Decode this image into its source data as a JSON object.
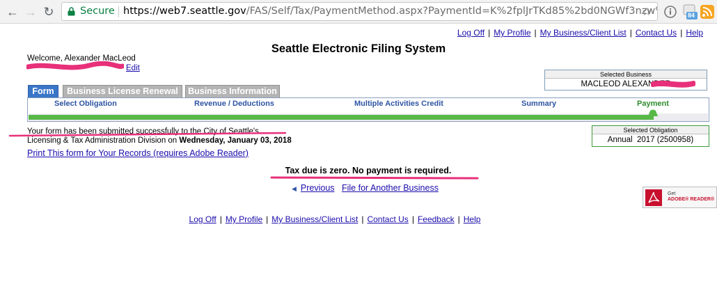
{
  "browser": {
    "secure_label": "Secure",
    "url_host": "https://web7.seattle.gov",
    "url_rest": "/FAS/Self/Tax/PaymentMethod.aspx?PaymentId=K%2fplJrTKd85%2bd0NGWf3nzw%3d%...",
    "extension_badge": "84"
  },
  "top_links": [
    "Log Off",
    "My Profile",
    "My Business/Client List",
    "Contact Us",
    "Help"
  ],
  "app_title": "Seattle Electronic Filing System",
  "welcome": "Welcome, Alexander MacLeod",
  "edit_label": "Edit",
  "selected_business": {
    "label": "Selected Business",
    "value": "MACLEOD ALEXANDER"
  },
  "tabs": [
    "Form",
    "Business License Renewal",
    "Business Information"
  ],
  "steps": [
    "Select Obligation",
    "Revenue / Deductions",
    "Multiple Activities Credit",
    "Summary",
    "Payment"
  ],
  "progress_fraction": 0.92,
  "colors": {
    "accent": "#3a76c8",
    "progress": "#58b848",
    "link": "#1a0dab",
    "redaction": "#e8307a"
  },
  "message": {
    "line1": "Your form has been submitted successfully to the City of Seattle's",
    "line2_prefix": "Licensing & Tax Administration Division on",
    "line2_date": "Wednesday, January 03, 2018"
  },
  "print_link": "Print This form for Your Records (requires Adobe Reader)",
  "selected_obligation": {
    "label": "Selected Obligation",
    "value": "Annual  2017 (2500958)"
  },
  "tax_message": "Tax due is zero. No payment is required.",
  "nav": {
    "previous": "Previous",
    "file_another": "File for Another Business"
  },
  "adobe": {
    "get": "Get",
    "reader": "ADOBE® READER®"
  },
  "footer_links": [
    "Log Off",
    "My Profile",
    "My Business/Client List",
    "Contact Us",
    "Feedback",
    "Help"
  ]
}
